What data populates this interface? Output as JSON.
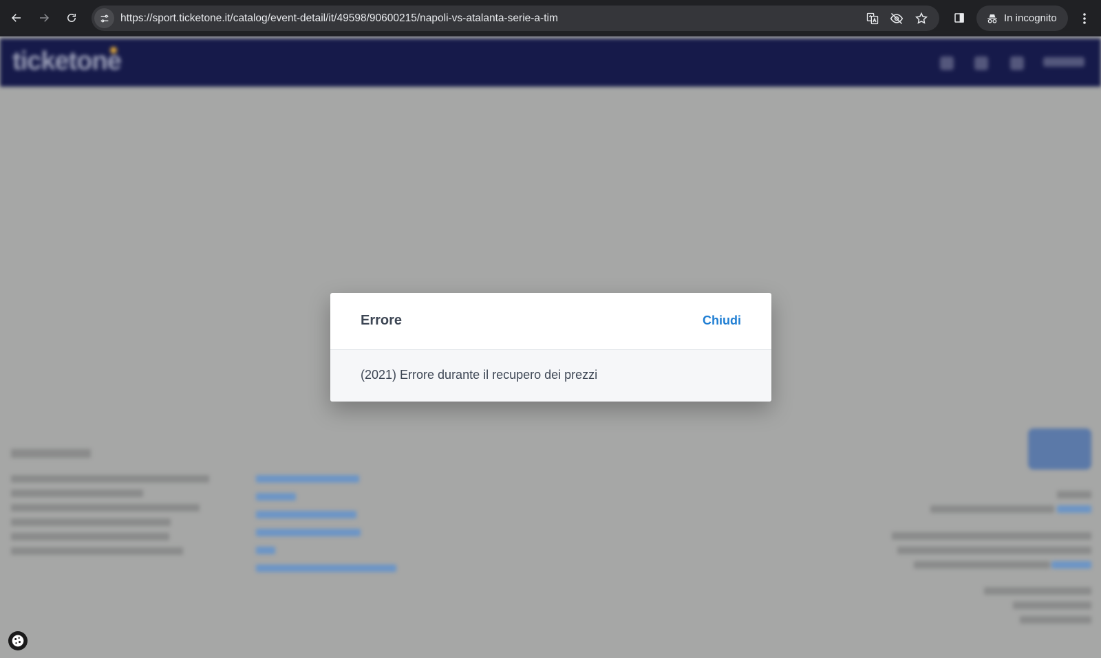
{
  "browser": {
    "url": "https://sport.ticketone.it/catalog/event-detail/it/49598/90600215/napoli-vs-atalanta-serie-a-tim",
    "incognito_label": "In incognito"
  },
  "modal": {
    "title": "Errore",
    "close_label": "Chiudi",
    "message": "(2021) Errore durante il recupero dei prezzi"
  },
  "site": {
    "logo": "ticketone"
  }
}
